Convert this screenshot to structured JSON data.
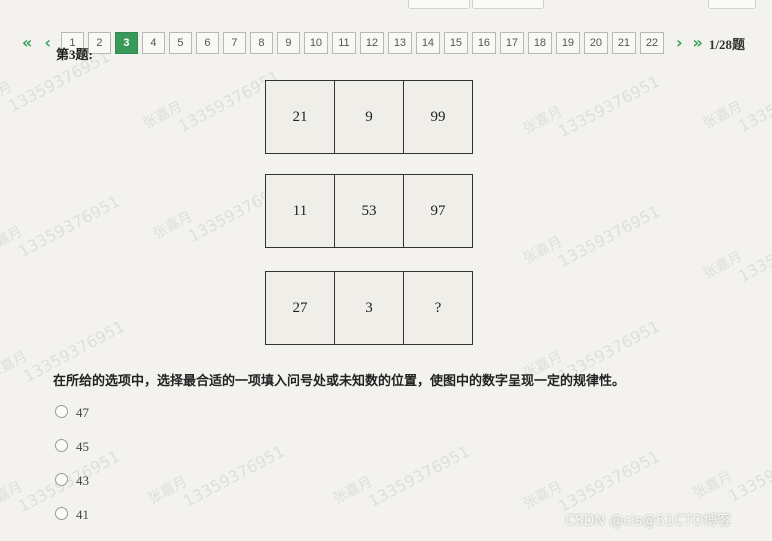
{
  "pagination": {
    "first_icon": "double-chevron-left-icon",
    "prev_icon": "chevron-left-icon",
    "next_icon": "chevron-right-icon",
    "last_icon": "double-chevron-right-icon",
    "pages": [
      "1",
      "2",
      "3",
      "4",
      "5",
      "6",
      "7",
      "8",
      "9",
      "10",
      "11",
      "12",
      "13",
      "14",
      "15",
      "16",
      "17",
      "18",
      "19",
      "20",
      "21",
      "22"
    ],
    "active_page": "3",
    "counter": "1/28题"
  },
  "question": {
    "title": "第3题:",
    "grid": [
      [
        "21",
        "9",
        "99"
      ],
      [
        "11",
        "53",
        "97"
      ],
      [
        "27",
        "3",
        "?"
      ]
    ],
    "prompt": "在所给的选项中，选择最合适的一项填入问号处或未知数的位置，使图中的数字呈现一定的规律性。",
    "options": [
      "47",
      "45",
      "43",
      "41"
    ]
  },
  "watermark": {
    "name": "张嘉月",
    "code": "13359376951"
  },
  "credit": "CSDN @cis@51CTO博客",
  "colors": {
    "accent": "#3a9a5a",
    "background": "#f3f2ee"
  }
}
